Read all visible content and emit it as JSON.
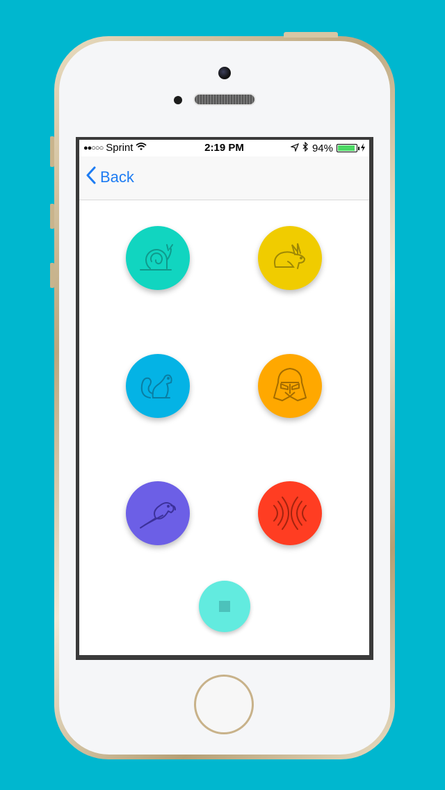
{
  "status_bar": {
    "signal": "●●○○○",
    "carrier": "Sprint",
    "time": "2:19 PM",
    "battery_percent": "94%",
    "battery_level": 0.94
  },
  "navbar": {
    "back_label": "Back"
  },
  "buttons": [
    {
      "id": "snail",
      "icon": "snail-icon",
      "color": "#11d5c0",
      "line": "#0f9a8c"
    },
    {
      "id": "rabbit",
      "icon": "rabbit-icon",
      "color": "#f0cc00",
      "line": "#9e8805"
    },
    {
      "id": "squirrel",
      "icon": "squirrel-icon",
      "color": "#04b3e5",
      "line": "#0a7ea3"
    },
    {
      "id": "darth-vader",
      "icon": "darth-vader-icon",
      "color": "#ffa800",
      "line": "#a46c00"
    },
    {
      "id": "parrot",
      "icon": "parrot-icon",
      "color": "#6c5fe6",
      "line": "#3c319a"
    },
    {
      "id": "echo",
      "icon": "echo-icon",
      "color": "#ff3d22",
      "line": "#a3240f"
    }
  ],
  "stop_button": {
    "icon": "stop-icon",
    "color": "#62ebdf"
  },
  "colors": {
    "background": "#00b7cf",
    "accent": "#1e7cf2"
  }
}
